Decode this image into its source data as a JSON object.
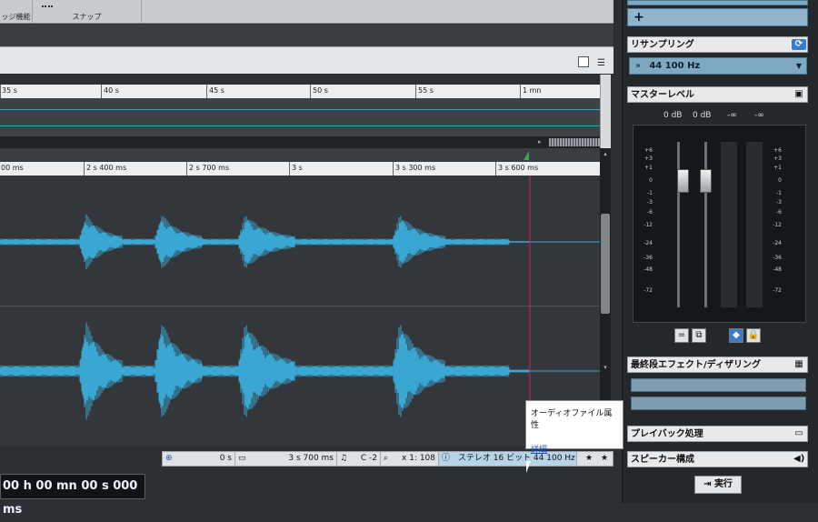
{
  "toolbar": {
    "group1_label": "ッジ機能",
    "group2_label": "スナップ"
  },
  "top_ruler": {
    "ticks": [
      "35 s",
      "40 s",
      "45 s",
      "50 s",
      "55 s",
      "1 mn"
    ]
  },
  "main_ruler": {
    "ticks": [
      "00 ms",
      "2 s 400 ms",
      "2 s 700 ms",
      "3 s",
      "3 s 300 ms",
      "3 s 600 ms"
    ]
  },
  "status": {
    "cursor_time": "0 s",
    "length": "3 s 700 ms",
    "pitch": "C -2",
    "zoom": "x 1: 108",
    "format": "ステレオ 16 ビット 44 100 Hz"
  },
  "time_display": "00 h 00 mn 00 s 000 ms",
  "tooltip": {
    "title": "オーディオファイル属性",
    "link": "詳細"
  },
  "right_panel": {
    "resampling": {
      "title": "リサンプリング",
      "value": "44 100 Hz"
    },
    "master": {
      "title": "マスターレベル",
      "readout_left": "0 dB",
      "readout_right": "0 dB",
      "peak_left": "-∞",
      "peak_right": "-∞",
      "scale": [
        "+6",
        "+3",
        "+1",
        "0",
        "-1",
        "-3",
        "-6",
        "-12",
        "-24",
        "-36",
        "-48",
        "-72"
      ]
    },
    "final_effects": {
      "title": "最終段エフェクト/ディザリング"
    },
    "playback": {
      "title": "プレイバック処理"
    },
    "speaker": {
      "title": "スピーカー構成"
    },
    "execute_label": "実行"
  },
  "colors": {
    "waveform": "#3aa7d3",
    "cursor": "#c0285a",
    "accent": "#5b8cb8"
  }
}
